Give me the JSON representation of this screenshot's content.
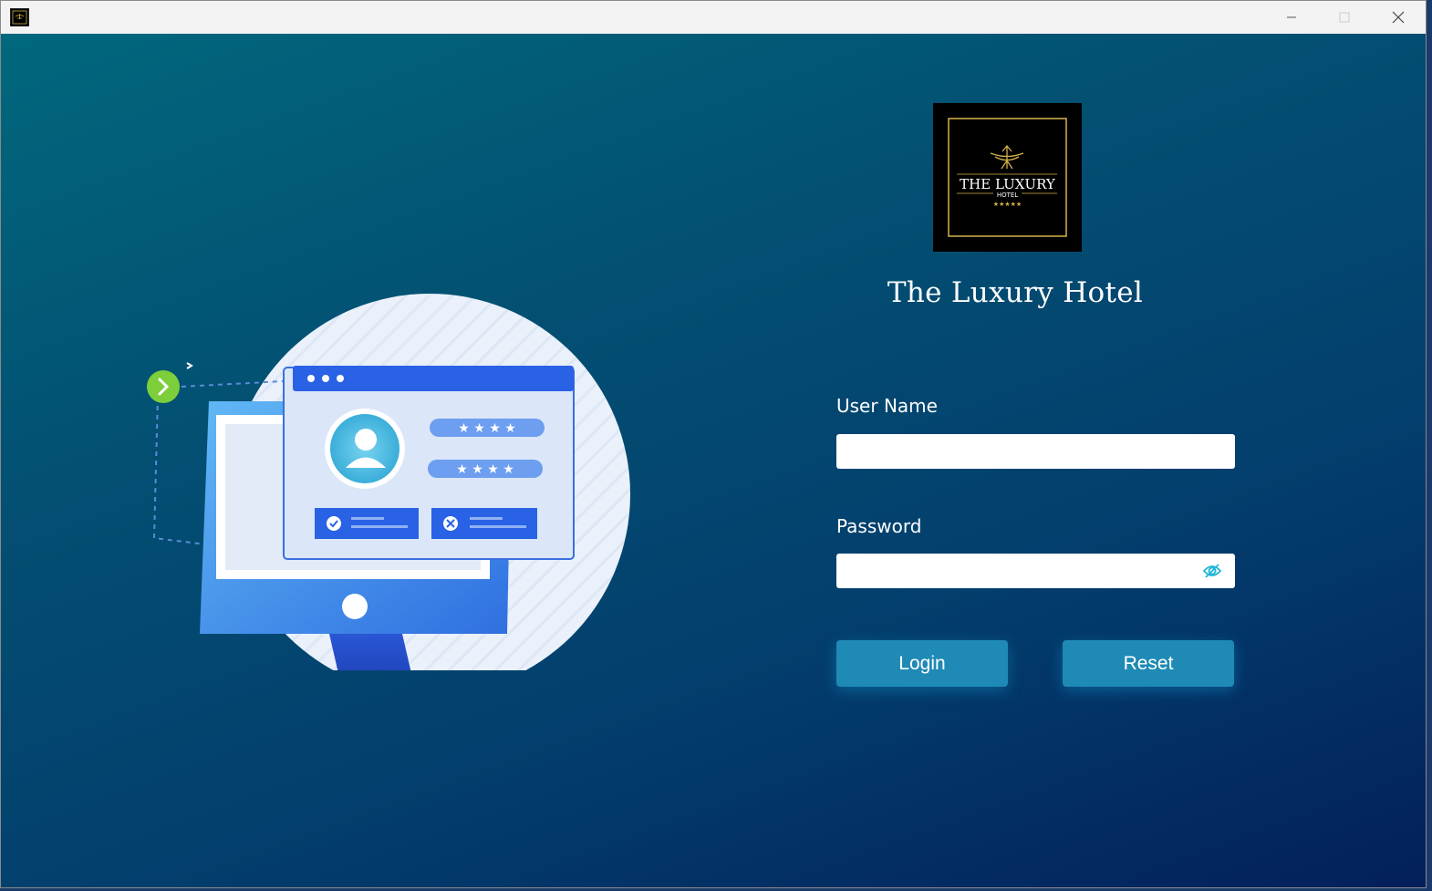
{
  "window": {
    "minimize_icon": "minimize-icon",
    "maximize_icon": "maximize-icon",
    "close_icon": "close-icon"
  },
  "logo": {
    "line1": "THE LUXURY",
    "line2": "HOTEL",
    "stars": "★★★★★"
  },
  "hotel_name": "The Luxury Hotel",
  "form": {
    "username_label": "User Name",
    "username_value": "",
    "password_label": "Password",
    "password_value": "",
    "toggle_icon": "eye-off-icon"
  },
  "buttons": {
    "login": "Login",
    "reset": "Reset"
  },
  "colors": {
    "gradient_start": "#01687d",
    "gradient_end": "#031f5c",
    "button": "#1f8ab5",
    "logo_gold": "#d4b24a"
  }
}
